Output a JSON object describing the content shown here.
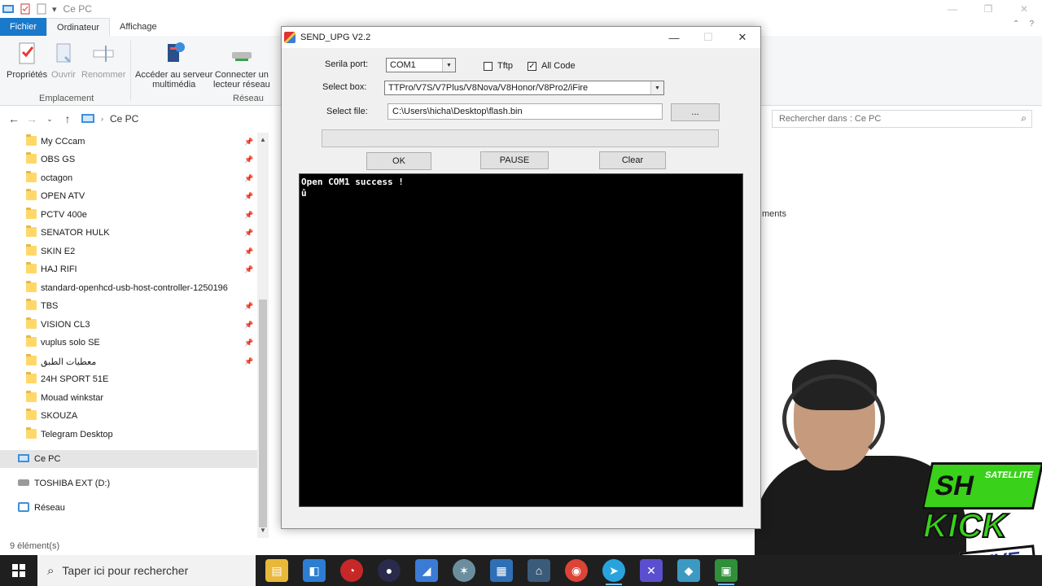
{
  "explorer": {
    "window_title": "Ce PC",
    "ribbon_tabs": [
      "Fichier",
      "Ordinateur",
      "Affichage"
    ],
    "ribbon": {
      "proprietes": "Propriétés",
      "ouvrir": "Ouvrir",
      "renommer": "Renommer",
      "acceder_line1": "Accéder au serveur",
      "acceder_line2": "multimédia",
      "connecter_line1": "Connecter un",
      "connecter_line2": "lecteur réseau",
      "group_emplacement": "Emplacement",
      "group_reseau": "Réseau"
    },
    "address": "Ce PC",
    "search_placeholder": "Rechercher dans : Ce PC",
    "folders": [
      "My CCcam",
      "OBS GS",
      "octagon",
      "OPEN ATV",
      "PCTV 400e",
      "SENATOR HULK",
      "SKIN E2",
      "HAJ RIFI",
      "standard-openhcd-usb-host-controller-1250196",
      "TBS",
      "VISION CL3",
      "vuplus solo SE",
      "معطيات الطبق",
      "24H SPORT 51E",
      "Mouad winkstar",
      "SKOUZA",
      "Telegram Desktop"
    ],
    "this_pc": "Ce PC",
    "drive": "TOSHIBA EXT (D:)",
    "network": "Réseau",
    "status": "9 élément(s)",
    "right_fragment": "ments"
  },
  "dialog": {
    "title": "SEND_UPG V2.2",
    "serial_label": "Serila port:",
    "serial_value": "COM1",
    "tftp_label": "Tftp",
    "tftp_checked": false,
    "allcode_label": "All Code",
    "allcode_checked": true,
    "box_label": "Select box:",
    "box_value": "TTPro/V7S/V7Plus/V8Nova/V8Honor/V8Pro2/iFire",
    "file_label": "Select file:",
    "file_value": "C:\\Users\\hicha\\Desktop\\flash.bin",
    "browse_label": "...",
    "progress": 0,
    "ok_label": "OK",
    "pause_label": "PAUSE",
    "clear_label": "Clear",
    "console_text": "Open COM1 success !\nû"
  },
  "overlay": {
    "logo_sh": "SH",
    "logo_satellite": "SATELLITE",
    "logo_kick": "KICK",
    "logo_live": "LIVE"
  },
  "taskbar": {
    "search_placeholder": "Taper ici pour rechercher"
  },
  "colors": {
    "ribbon_file_tab": "#1979ca",
    "accent_green": "#39d11a",
    "taskbar": "#1f1f1f"
  }
}
